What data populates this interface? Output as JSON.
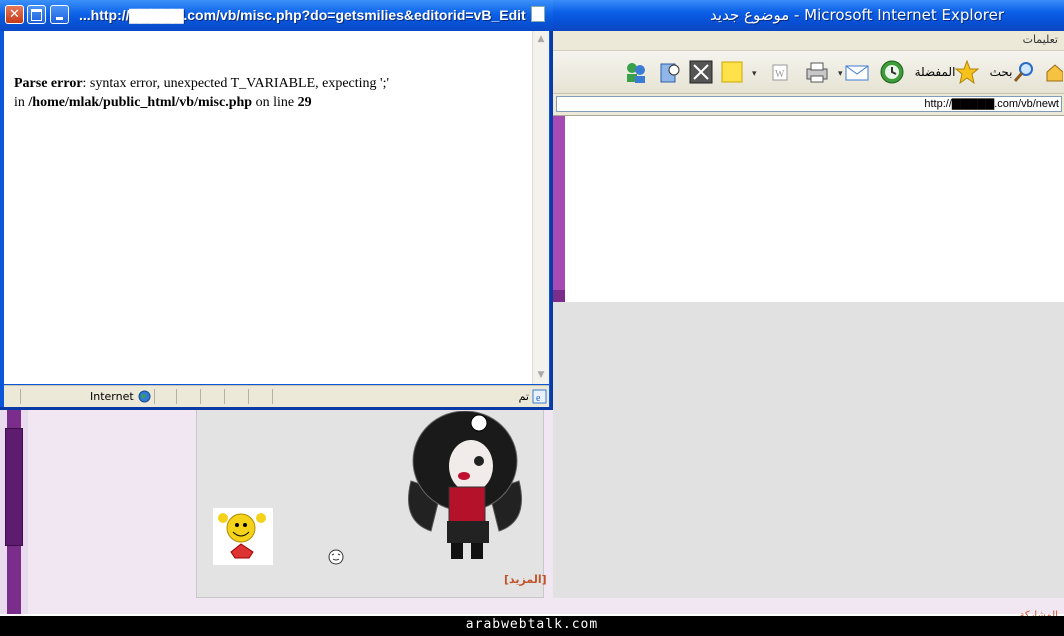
{
  "background_window": {
    "title": "موضوع جديد - Microsoft Internet Explorer",
    "menu": {
      "help": "تعليمات"
    },
    "toolbar": {
      "search_label": "بحث",
      "favorites_label": "المفضلة"
    },
    "address": "http://▇▇▇▇▇.com/vb/newt",
    "smilies_more_link": "[المزيد]",
    "partial_footer_text": "المشاركة"
  },
  "popup": {
    "title": "...http://▇▇▇▇▇.com/vb/misc.php?do=getsmilies&editorid=vB_Edit",
    "error": {
      "label": "Parse error",
      "message": ": syntax error, unexpected T_VARIABLE, expecting ';'",
      "in_text": "in",
      "path": "/home/mlak/public_html/vb/misc.php",
      "on_line_text": "on line",
      "line": "29"
    },
    "status": {
      "zone_label": "Internet",
      "done_label": "تم"
    }
  },
  "watermark": "arabwebtalk.com",
  "colors": {
    "xp_title_blue": "#0853d8",
    "forum_purple": "#7b2d8b",
    "link_orange": "#c0542a"
  }
}
